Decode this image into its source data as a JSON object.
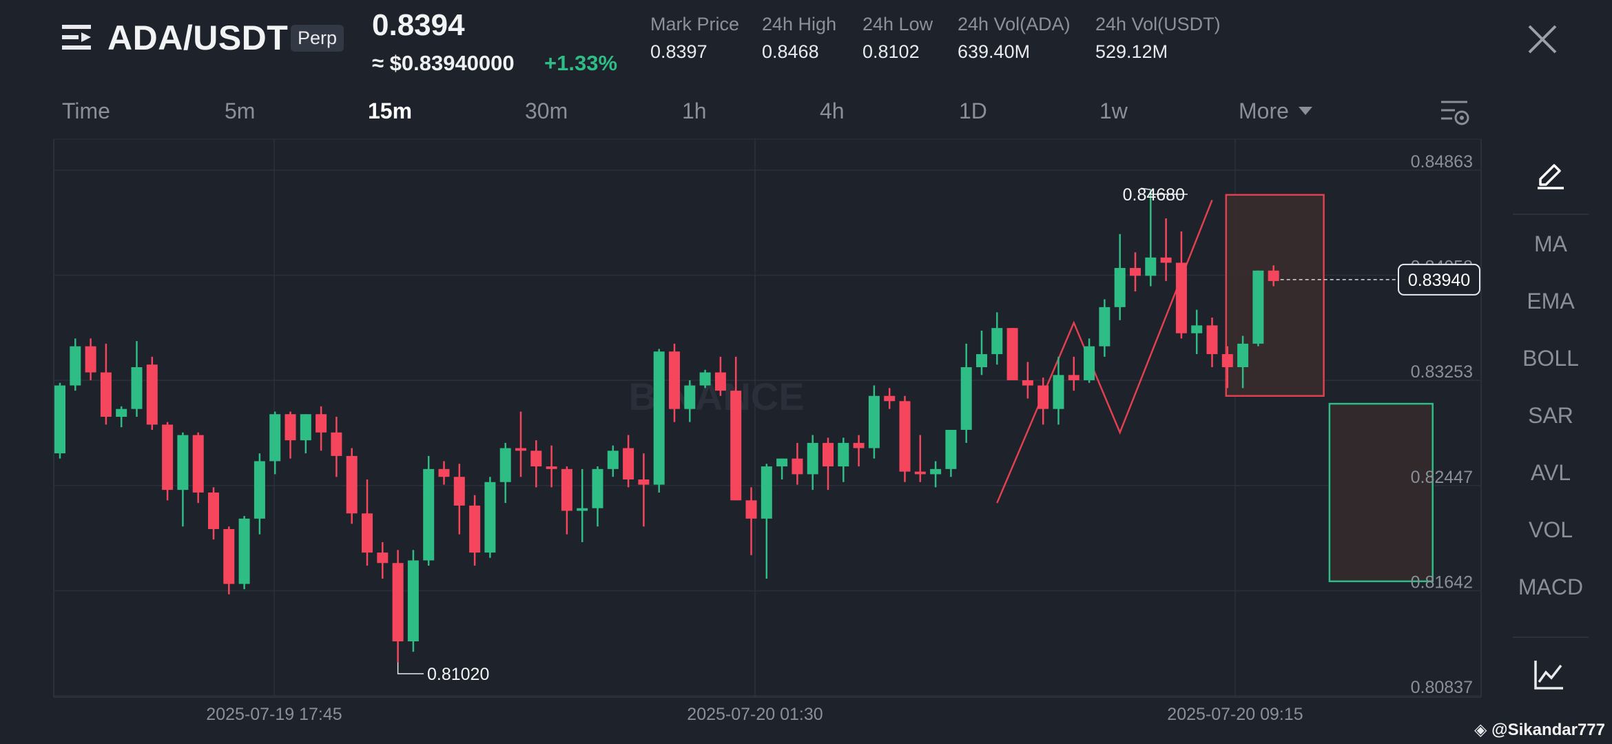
{
  "header": {
    "symbol": "ADA/USDT",
    "badge": "Perp",
    "last_price": "0.8394",
    "usd_price": "≈ $0.83940000",
    "change": "+1.33%",
    "stats": [
      {
        "label": "Mark Price",
        "value": "0.8397"
      },
      {
        "label": "24h High",
        "value": "0.8468"
      },
      {
        "label": "24h Low",
        "value": "0.8102"
      },
      {
        "label": "24h Vol(ADA)",
        "value": "639.40M"
      },
      {
        "label": "24h Vol(USDT)",
        "value": "529.12M"
      }
    ]
  },
  "tabs": [
    "Time",
    "5m",
    "15m",
    "30m",
    "1h",
    "4h",
    "1D",
    "1w",
    "More"
  ],
  "active_tab": "15m",
  "side_tools": [
    "MA",
    "EMA",
    "BOLL",
    "SAR",
    "AVL",
    "VOL",
    "MACD"
  ],
  "watermark": "BINANCE",
  "credit": "@Sikandar777",
  "colors": {
    "up": "#2ebd85",
    "down": "#f6465d",
    "bg": "#1e222b",
    "grid": "#2b303a"
  },
  "chart_data": {
    "type": "candlestick",
    "price_ticks": [
      "0.84863",
      "0.84058",
      "0.83253",
      "0.82447",
      "0.81642",
      "0.80837"
    ],
    "price_range": [
      0.80837,
      0.84863
    ],
    "time_labels": [
      "2025-07-19 17:45",
      "2025-07-20 01:30",
      "2025-07-20 09:15"
    ],
    "current_price_label": "0.83940",
    "high_marker": "0.84680",
    "low_marker": "0.81020",
    "candles": [
      [
        0.8262,
        0.8316,
        0.8258,
        0.8314
      ],
      [
        0.8314,
        0.835,
        0.831,
        0.8344
      ],
      [
        0.8344,
        0.835,
        0.8318,
        0.8324
      ],
      [
        0.8324,
        0.8346,
        0.8284,
        0.829
      ],
      [
        0.829,
        0.8298,
        0.8282,
        0.8296
      ],
      [
        0.8296,
        0.8348,
        0.829,
        0.8328
      ],
      [
        0.833,
        0.8336,
        0.828,
        0.8284
      ],
      [
        0.8284,
        0.8286,
        0.8226,
        0.8234
      ],
      [
        0.8234,
        0.8278,
        0.8206,
        0.8276
      ],
      [
        0.8276,
        0.8278,
        0.8224,
        0.8232
      ],
      [
        0.8232,
        0.8236,
        0.8196,
        0.8204
      ],
      [
        0.8204,
        0.8206,
        0.8154,
        0.8162
      ],
      [
        0.8162,
        0.8214,
        0.8158,
        0.8212
      ],
      [
        0.8212,
        0.8262,
        0.82,
        0.8256
      ],
      [
        0.8256,
        0.8294,
        0.8246,
        0.8292
      ],
      [
        0.8292,
        0.8294,
        0.8258,
        0.8272
      ],
      [
        0.8272,
        0.8292,
        0.8262,
        0.8292
      ],
      [
        0.8292,
        0.8298,
        0.8264,
        0.8278
      ],
      [
        0.8278,
        0.829,
        0.8244,
        0.826
      ],
      [
        0.826,
        0.8266,
        0.8208,
        0.8216
      ],
      [
        0.8216,
        0.8242,
        0.8176,
        0.8186
      ],
      [
        0.8186,
        0.8194,
        0.8166,
        0.8178
      ],
      [
        0.8178,
        0.8188,
        0.8102,
        0.8118
      ],
      [
        0.8118,
        0.8188,
        0.811,
        0.818
      ],
      [
        0.818,
        0.826,
        0.8176,
        0.825
      ],
      [
        0.825,
        0.8256,
        0.8238,
        0.8244
      ],
      [
        0.8244,
        0.8254,
        0.82,
        0.8222
      ],
      [
        0.8222,
        0.823,
        0.8176,
        0.8186
      ],
      [
        0.8186,
        0.8244,
        0.8182,
        0.824
      ],
      [
        0.824,
        0.827,
        0.8224,
        0.8266
      ],
      [
        0.8266,
        0.8294,
        0.8244,
        0.8264
      ],
      [
        0.8264,
        0.8272,
        0.8236,
        0.8252
      ],
      [
        0.8252,
        0.8268,
        0.8236,
        0.825
      ],
      [
        0.825,
        0.8252,
        0.82,
        0.8218
      ],
      [
        0.8218,
        0.825,
        0.8194,
        0.822
      ],
      [
        0.822,
        0.8252,
        0.8206,
        0.825
      ],
      [
        0.825,
        0.8268,
        0.8244,
        0.8264
      ],
      [
        0.8266,
        0.8276,
        0.8236,
        0.8242
      ],
      [
        0.8242,
        0.8262,
        0.8206,
        0.8238
      ],
      [
        0.8238,
        0.8342,
        0.8232,
        0.834
      ],
      [
        0.834,
        0.8346,
        0.8286,
        0.8296
      ],
      [
        0.8296,
        0.8318,
        0.8286,
        0.8314
      ],
      [
        0.8314,
        0.8326,
        0.8312,
        0.8324
      ],
      [
        0.8324,
        0.8336,
        0.8306,
        0.831
      ],
      [
        0.831,
        0.8336,
        0.8248,
        0.8226
      ],
      [
        0.8226,
        0.8236,
        0.8184,
        0.8212
      ],
      [
        0.8212,
        0.8254,
        0.8166,
        0.8252
      ],
      [
        0.8252,
        0.8258,
        0.8242,
        0.8258
      ],
      [
        0.8258,
        0.827,
        0.8238,
        0.8246
      ],
      [
        0.8246,
        0.8276,
        0.8234,
        0.827
      ],
      [
        0.827,
        0.8274,
        0.8234,
        0.8252
      ],
      [
        0.8252,
        0.8274,
        0.824,
        0.827
      ],
      [
        0.827,
        0.8276,
        0.8252,
        0.8266
      ],
      [
        0.8266,
        0.8314,
        0.8258,
        0.8306
      ],
      [
        0.8306,
        0.8312,
        0.8296,
        0.8302
      ],
      [
        0.8302,
        0.8306,
        0.824,
        0.8248
      ],
      [
        0.8248,
        0.8276,
        0.824,
        0.8246
      ],
      [
        0.8246,
        0.8256,
        0.8236,
        0.825
      ],
      [
        0.825,
        0.828,
        0.8244,
        0.828
      ],
      [
        0.828,
        0.8346,
        0.827,
        0.8328
      ],
      [
        0.8328,
        0.8356,
        0.8322,
        0.8338
      ],
      [
        0.8338,
        0.837,
        0.833,
        0.8358
      ],
      [
        0.8358,
        0.8358,
        0.8318,
        0.8318
      ],
      [
        0.8318,
        0.8332,
        0.8304,
        0.8314
      ],
      [
        0.8314,
        0.832,
        0.8284,
        0.8296
      ],
      [
        0.8296,
        0.8336,
        0.8284,
        0.8322
      ],
      [
        0.8322,
        0.8336,
        0.831,
        0.8318
      ],
      [
        0.8318,
        0.835,
        0.8316,
        0.8344
      ],
      [
        0.8344,
        0.838,
        0.8336,
        0.8374
      ],
      [
        0.8374,
        0.843,
        0.8364,
        0.8404
      ],
      [
        0.8404,
        0.8416,
        0.8386,
        0.8398
      ],
      [
        0.8398,
        0.8464,
        0.839,
        0.8412
      ],
      [
        0.8412,
        0.8442,
        0.8394,
        0.8408
      ],
      [
        0.8408,
        0.8432,
        0.835,
        0.8354
      ],
      [
        0.8354,
        0.8372,
        0.8338,
        0.836
      ],
      [
        0.836,
        0.8366,
        0.8328,
        0.8338
      ],
      [
        0.8338,
        0.8344,
        0.8312,
        0.8328
      ],
      [
        0.8328,
        0.8352,
        0.8312,
        0.8346
      ],
      [
        0.8346,
        0.8402,
        0.8344,
        0.8402
      ],
      [
        0.8402,
        0.8406,
        0.839,
        0.8394
      ]
    ],
    "annotations": {
      "highlight_box": {
        "from_candle": 76,
        "to_candle": 82,
        "top": 0.846,
        "bottom": 0.8306
      },
      "target_box": {
        "from_candle": 83,
        "to_candle": 89,
        "top": 0.83,
        "bottom": 0.8164
      },
      "trend_path": [
        [
          0.8224,
          61
        ],
        [
          0.8362,
          66
        ],
        [
          0.8278,
          69
        ],
        [
          0.8456,
          75
        ]
      ]
    }
  }
}
